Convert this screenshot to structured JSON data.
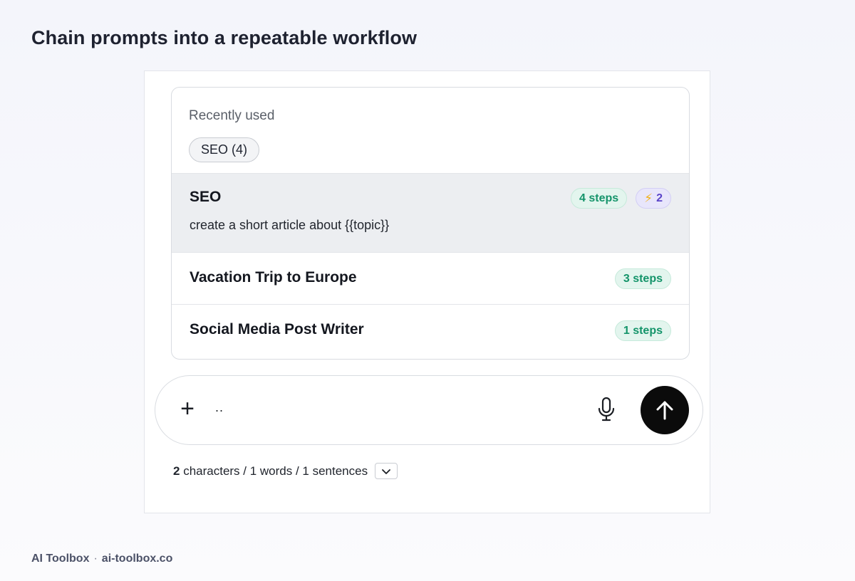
{
  "page": {
    "title": "Chain prompts into a repeatable workflow"
  },
  "dropdown": {
    "recent_label": "Recently used",
    "recent_chip": "SEO (4)",
    "items": [
      {
        "title": "SEO",
        "description": "create a short article about {{topic}}",
        "steps": "4 steps",
        "bolt_count": "2"
      },
      {
        "title": "Vacation Trip to Europe",
        "steps": "3 steps"
      },
      {
        "title": "Social Media Post Writer",
        "steps": "1 steps"
      }
    ]
  },
  "composer": {
    "value": "..",
    "plus_icon": "plus-icon",
    "mic_icon": "microphone-icon",
    "send_icon": "arrow-up-icon"
  },
  "stats": {
    "characters_count": "2",
    "rest": " characters / 1 words / 1 sentences"
  },
  "footer": {
    "brand": "AI Toolbox",
    "separator": "·",
    "domain": "ai-toolbox.co"
  },
  "colors": {
    "steps_badge": "#14946a",
    "bolt_badge": "#5b45c9",
    "send_button": "#0b0b0b"
  }
}
